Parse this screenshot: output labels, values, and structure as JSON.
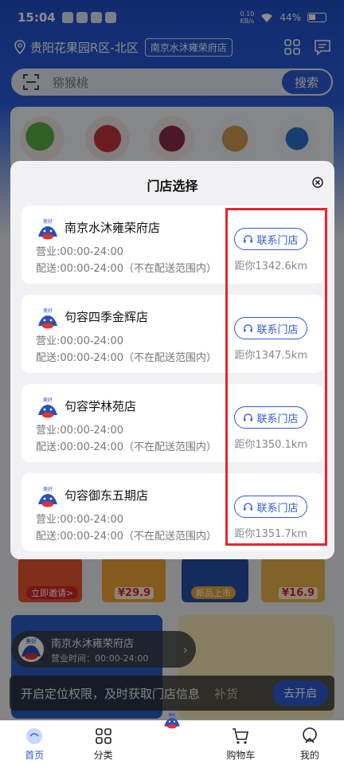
{
  "status_bar": {
    "time": "15:04",
    "net_speed_value": "0.10",
    "net_speed_unit": "KB/s",
    "battery": "44%"
  },
  "header": {
    "location": "贵阳花果园R区-北区",
    "current_store": "南京水沐雍荣府店",
    "search_placeholder": "猕猴桃",
    "search_button": "搜索"
  },
  "products": {
    "tag_invite": "立即邀请>",
    "price_1": "¥29.9",
    "tag_new": "新品上市",
    "price_2": "¥16.9"
  },
  "floating_store": {
    "logo_text": "美好",
    "name": "南京水沐雍荣府店",
    "hours": "营业时间：00:00-24:00"
  },
  "permission_bar": {
    "text": "开启定位权限，及时获取门店信息",
    "button": "去开启",
    "behind_text": "补货"
  },
  "dialog": {
    "title": "门店选择",
    "contact_label": "联系门店",
    "logo_text": "美好",
    "stores": [
      {
        "name": "南京水沐雍荣府店",
        "hours": "营业:00:00-24:00",
        "delivery": "配送:00:00-24:00（不在配送范围内）",
        "distance": "距你1342.6km"
      },
      {
        "name": "句容四季金辉店",
        "hours": "营业:00:00-24:00",
        "delivery": "配送:00:00-24:00（不在配送范围内）",
        "distance": "距你1347.5km"
      },
      {
        "name": "句容学林苑店",
        "hours": "营业:00:00-24:00",
        "delivery": "配送:00:00-24:00（不在配送范围内）",
        "distance": "距你1350.1km"
      },
      {
        "name": "句容御东五期店",
        "hours": "营业:00:00-24:00",
        "delivery": "配送:00:00-24:00（不在配送范围内）",
        "distance": "距你1351.7km"
      }
    ]
  },
  "tabbar": {
    "home": "首页",
    "category": "分类",
    "center_logo": "美好",
    "cart": "购物车",
    "mine": "我的"
  },
  "colors": {
    "brand_blue": "#2f5bd8",
    "highlight_red": "#e8252c"
  }
}
